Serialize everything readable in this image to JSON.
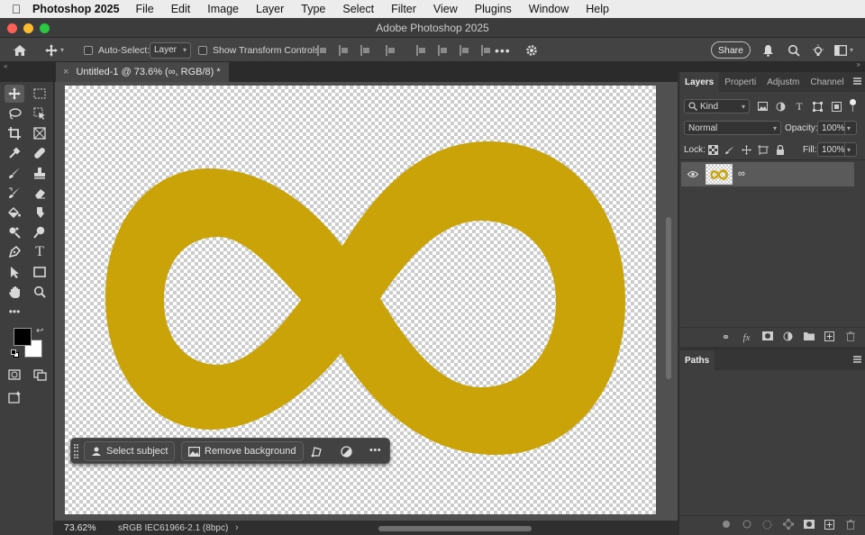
{
  "menubar": {
    "app_name": "Photoshop 2025",
    "items": [
      "File",
      "Edit",
      "Image",
      "Layer",
      "Type",
      "Select",
      "Filter",
      "View",
      "Plugins",
      "Window",
      "Help"
    ]
  },
  "window": {
    "title": "Adobe Photoshop 2025"
  },
  "options_bar": {
    "auto_select_label": "Auto-Select:",
    "auto_select_target": "Layer",
    "show_transform_label": "Show Transform Controls",
    "share_label": "Share"
  },
  "document_tab": {
    "label": "Untitled-1 @ 73.6% (∞, RGB/8) *",
    "close": "×"
  },
  "canvas": {
    "shape_symbol": "∞",
    "shape_color": "#c9a308"
  },
  "taskbar": {
    "select_subject": "Select subject",
    "remove_background": "Remove background"
  },
  "status": {
    "zoom": "73.62%",
    "color_profile": "sRGB IEC61966-2.1 (8bpc)",
    "arrow": "›"
  },
  "layers_panel": {
    "tabs": [
      "Layers",
      "Properti",
      "Adjustm",
      "Channel"
    ],
    "filter_kind": "Kind",
    "blend_mode": "Normal",
    "opacity_label": "Opacity:",
    "opacity_value": "100%",
    "lock_label": "Lock:",
    "fill_label": "Fill:",
    "fill_value": "100%",
    "layers": [
      {
        "name": "∞",
        "visible": true
      }
    ]
  },
  "paths_panel": {
    "tab": "Paths"
  },
  "colors": {
    "foreground": "#000000",
    "background": "#ffffff"
  }
}
